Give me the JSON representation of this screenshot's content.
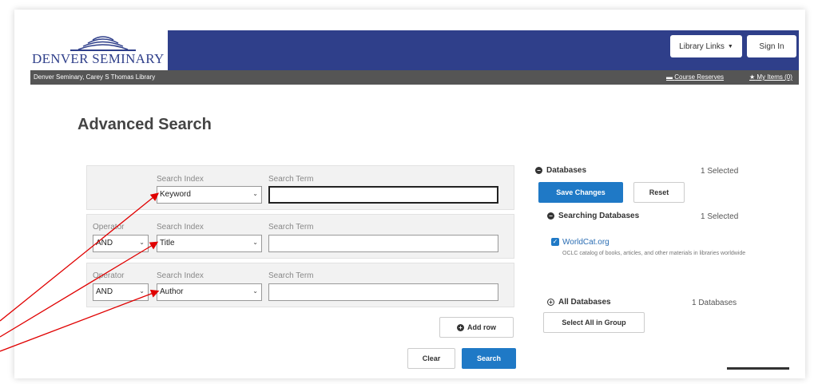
{
  "header": {
    "logo_text": "DENVER SEMINARY",
    "library_links": "Library Links",
    "sign_in": "Sign In",
    "library_name": "Denver Seminary, Carey S Thomas Library",
    "course_reserves": "Course Reserves",
    "my_items": "My Items (0)"
  },
  "page": {
    "title": "Advanced Search"
  },
  "search": {
    "search_index_label": "Search Index",
    "search_term_label": "Search Term",
    "operator_label": "Operator",
    "rows": [
      {
        "operator": "",
        "index": "Keyword",
        "term": ""
      },
      {
        "operator": "AND",
        "index": "Title",
        "term": ""
      },
      {
        "operator": "AND",
        "index": "Author",
        "term": ""
      }
    ],
    "add_row": "Add row",
    "clear": "Clear",
    "search": "Search"
  },
  "databases": {
    "title": "Databases",
    "selected_count": "1 Selected",
    "save_changes": "Save Changes",
    "reset": "Reset",
    "searching_title": "Searching Databases",
    "searching_count": "1 Selected",
    "worldcat_name": "WorldCat.org",
    "worldcat_desc": "OCLC catalog of books, articles, and other materials in libraries worldwide",
    "all_title": "All Databases",
    "all_count": "1 Databases",
    "select_all": "Select All in Group"
  },
  "colors": {
    "brand": "#2f3f8a",
    "primary_button": "#1f79c6",
    "annotation_arrow": "#e00000"
  }
}
